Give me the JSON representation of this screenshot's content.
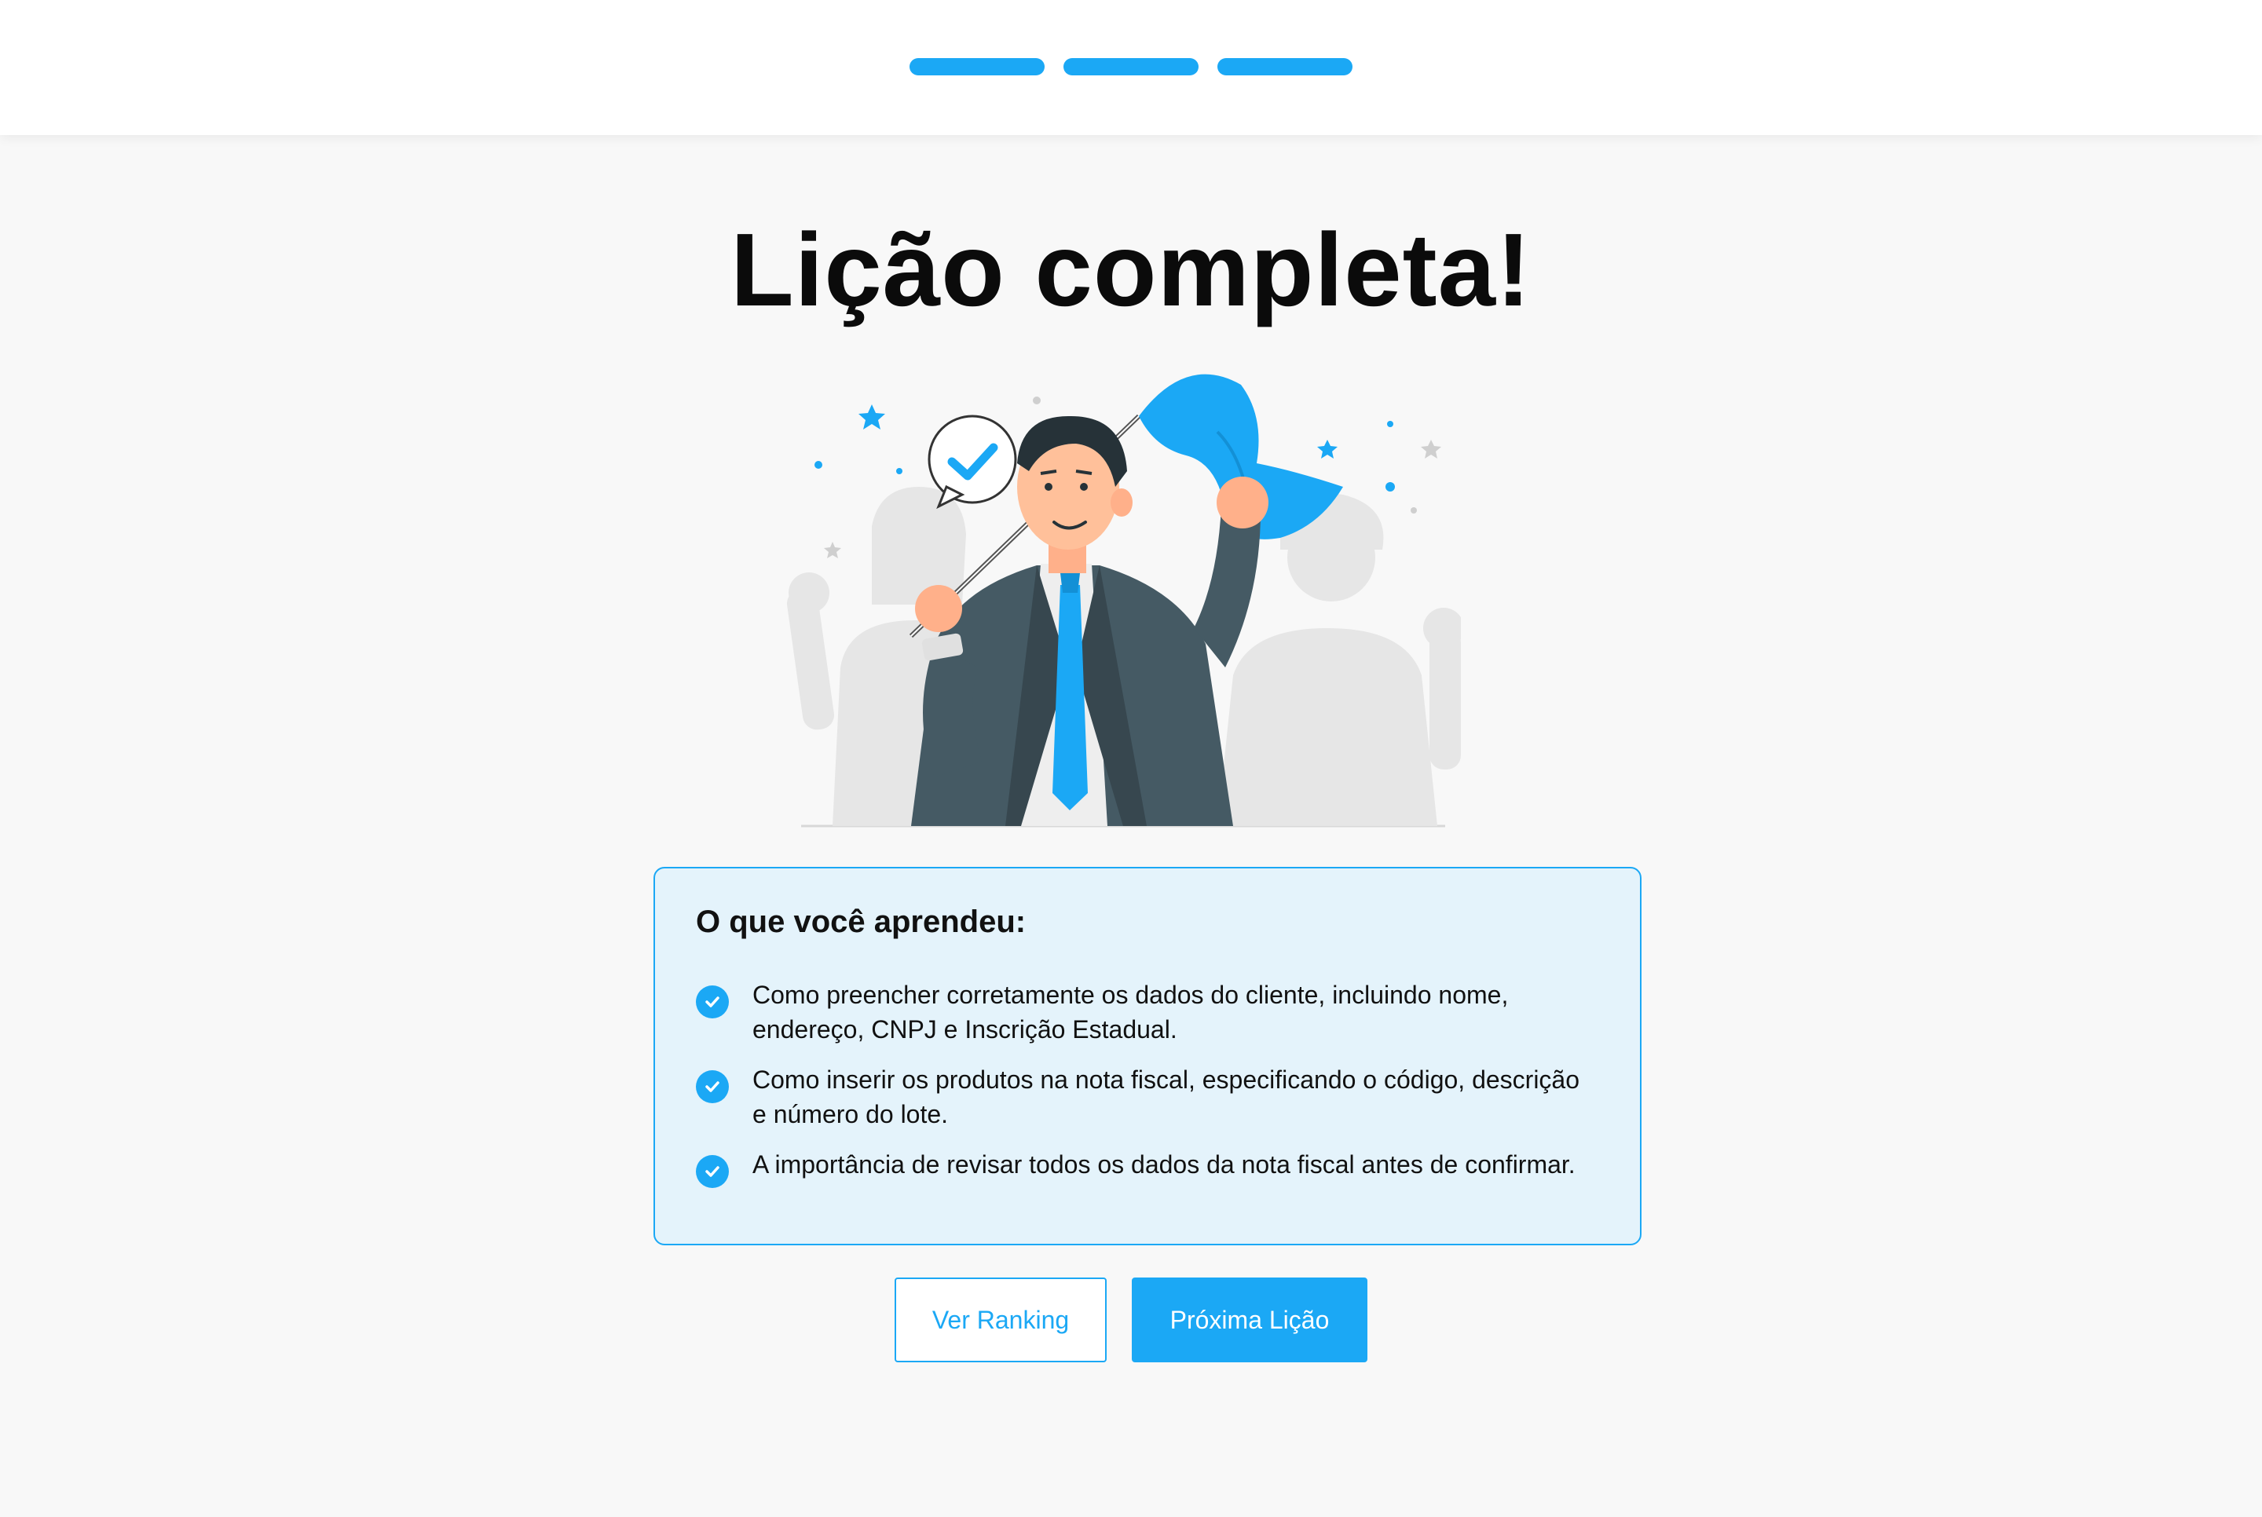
{
  "progress": {
    "total_steps": 3,
    "completed_steps": 3,
    "color": "#1ba8f5"
  },
  "page": {
    "title": "Lição completa!"
  },
  "learned": {
    "title": "O que você aprendeu:",
    "items": [
      {
        "icon": "check-circle-icon",
        "text": "Como preencher corretamente os dados do cliente, incluindo nome, endereço, CNPJ e Inscrição Estadual."
      },
      {
        "icon": "check-circle-icon",
        "text": "Como inserir os produtos na nota fiscal, especificando o código, descrição e número do lote."
      },
      {
        "icon": "check-circle-icon",
        "text": "A importância de revisar todos os dados da nota fiscal antes de confirmar."
      }
    ]
  },
  "actions": {
    "ranking_label": "Ver Ranking",
    "next_label": "Próxima Lição"
  },
  "colors": {
    "accent": "#1ba8f5",
    "card_bg": "#e4f3fb",
    "background": "#f8f8f8"
  }
}
